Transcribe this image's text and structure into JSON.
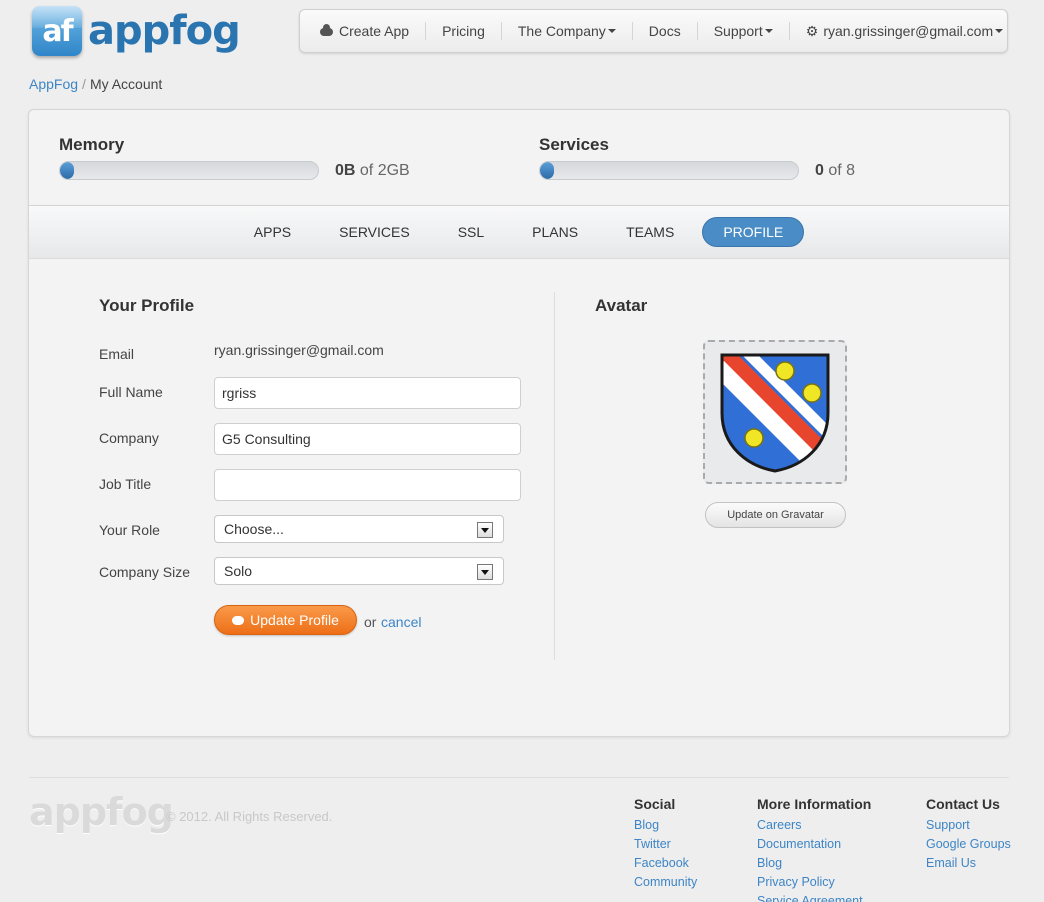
{
  "brand": {
    "logo_mark": "af",
    "logo_text": "appfog"
  },
  "nav": {
    "create_app": "Create App",
    "pricing": "Pricing",
    "company": "The Company",
    "docs": "Docs",
    "support": "Support",
    "account": "ryan.grissinger@gmail.com"
  },
  "breadcrumb": {
    "root": "AppFog",
    "separator": "/",
    "current": "My Account"
  },
  "usage": {
    "memory": {
      "label": "Memory",
      "used": "0B",
      "of_text": "of 2GB",
      "fraction": 0
    },
    "services": {
      "label": "Services",
      "used": "0",
      "of_text": "of 8",
      "fraction": 0
    }
  },
  "tabs": [
    "APPS",
    "SERVICES",
    "SSL",
    "PLANS",
    "TEAMS",
    "PROFILE"
  ],
  "active_tab": "PROFILE",
  "profile": {
    "title": "Your Profile",
    "email_label": "Email",
    "email_value": "ryan.grissinger@gmail.com",
    "full_name_label": "Full Name",
    "full_name_value": "rgriss",
    "company_label": "Company",
    "company_value": "G5 Consulting",
    "job_title_label": "Job Title",
    "job_title_value": "",
    "role_label": "Your Role",
    "role_value": "Choose...",
    "company_size_label": "Company Size",
    "company_size_value": "Solo",
    "update_button": "Update Profile",
    "or_text": "or",
    "cancel_link": "cancel"
  },
  "avatar": {
    "title": "Avatar",
    "gravatar_button": "Update on Gravatar"
  },
  "footer": {
    "logo_text": "appfog",
    "copyright": "© 2012. All Rights Reserved.",
    "social": {
      "title": "Social",
      "links": [
        "Blog",
        "Twitter",
        "Facebook",
        "Community"
      ]
    },
    "more_info": {
      "title": "More Information",
      "links": [
        "Careers",
        "Documentation",
        "Blog",
        "Privacy Policy",
        "Service Agreement"
      ]
    },
    "contact": {
      "title": "Contact Us",
      "links": [
        "Support",
        "Google Groups",
        "Email Us"
      ]
    }
  },
  "colors": {
    "accent_blue": "#4a8cc6",
    "orange_button": "#ed6f17",
    "link": "#3d85c6"
  }
}
